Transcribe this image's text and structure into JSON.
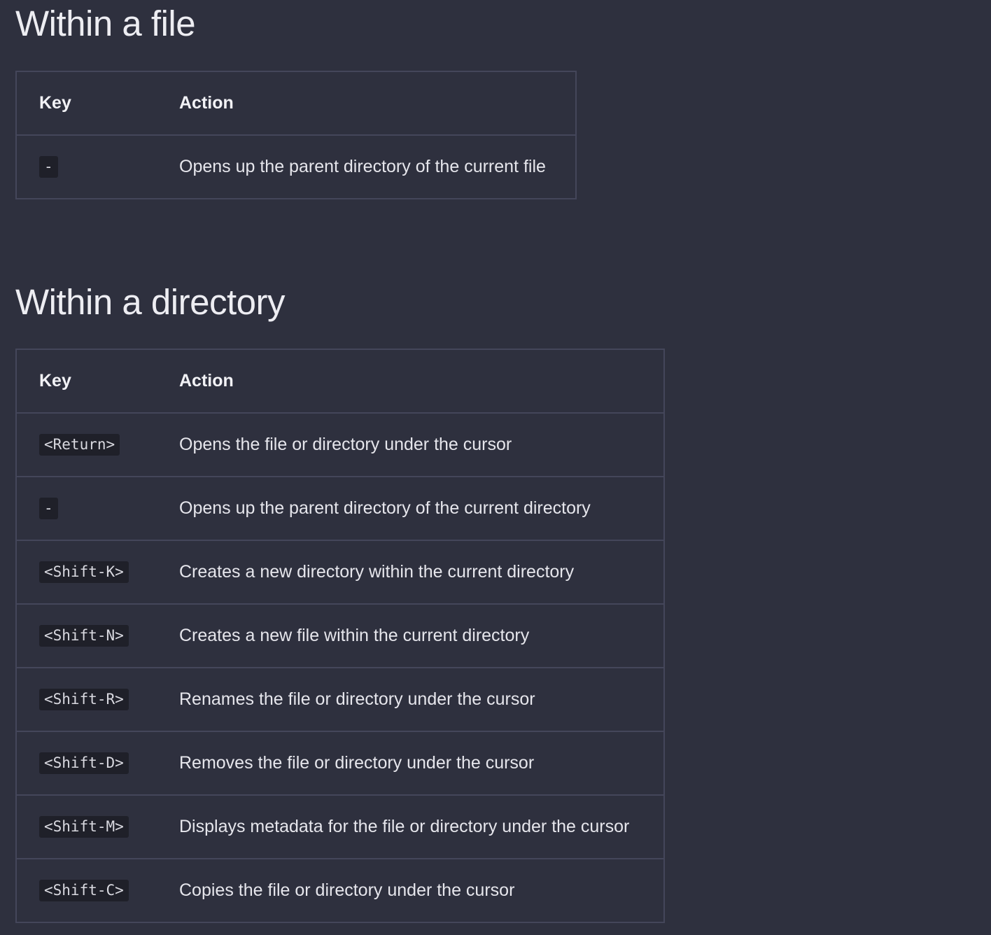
{
  "section_file": {
    "title": "Within a file",
    "header_key": "Key",
    "header_action": "Action",
    "rows": [
      {
        "key": "-",
        "action": "Opens up the parent directory of the current file"
      }
    ]
  },
  "section_dir": {
    "title": "Within a directory",
    "header_key": "Key",
    "header_action": "Action",
    "rows": [
      {
        "key": "<Return>",
        "action": "Opens the file or directory under the cursor"
      },
      {
        "key": "-",
        "action": "Opens up the parent directory of the current directory"
      },
      {
        "key": "<Shift-K>",
        "action": "Creates a new directory within the current directory"
      },
      {
        "key": "<Shift-N>",
        "action": "Creates a new file within the current directory"
      },
      {
        "key": "<Shift-R>",
        "action": "Renames the file or directory under the cursor"
      },
      {
        "key": "<Shift-D>",
        "action": "Removes the file or directory under the cursor"
      },
      {
        "key": "<Shift-M>",
        "action": "Displays metadata for the file or directory under the cursor"
      },
      {
        "key": "<Shift-C>",
        "action": "Copies the file or directory under the cursor"
      }
    ]
  }
}
